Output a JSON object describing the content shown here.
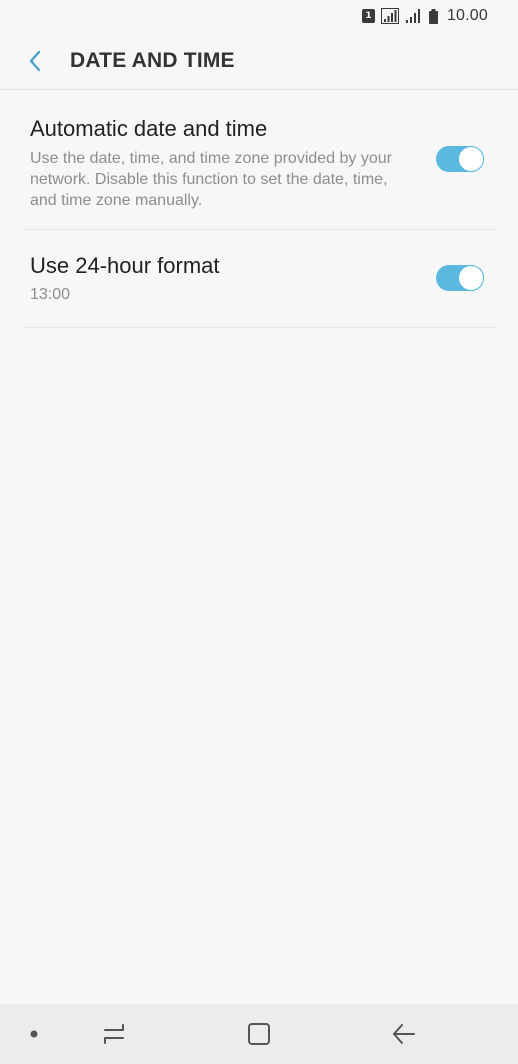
{
  "status_bar": {
    "sim_label": "1",
    "time": "10.00"
  },
  "header": {
    "title": "DATE AND TIME",
    "back_icon": "chevron-left-icon"
  },
  "settings": [
    {
      "title": "Automatic date and time",
      "description": "Use the date, time, and time zone provided by your network. Disable this function to set the date, time, and time zone manually.",
      "enabled": true
    },
    {
      "title": "Use 24-hour format",
      "description": "13:00",
      "enabled": true
    }
  ],
  "colors": {
    "accent": "#5bb8df",
    "background": "#f7f7f7",
    "nav_bar": "#ececec"
  },
  "nav_bar": {
    "icons": [
      "dot-icon",
      "recents-icon",
      "home-icon",
      "back-icon"
    ]
  }
}
